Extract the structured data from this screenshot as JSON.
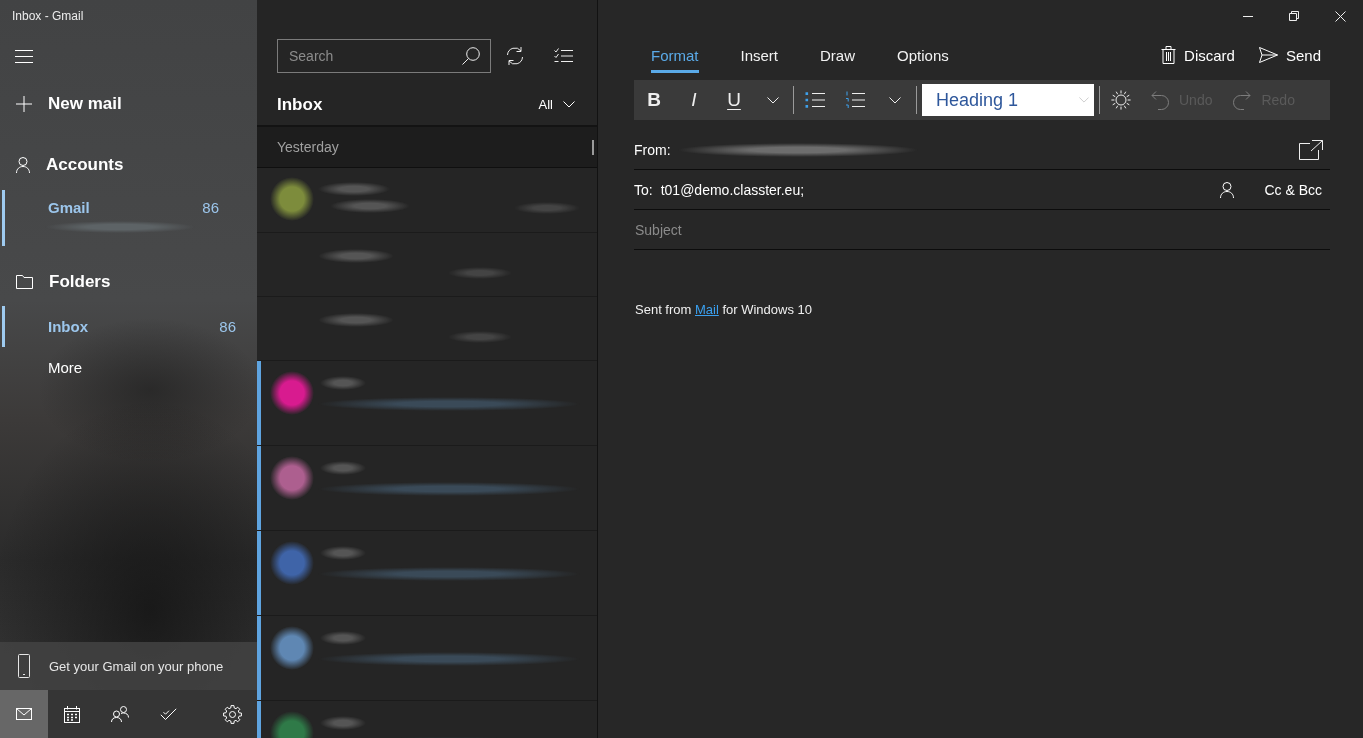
{
  "window": {
    "title": "Inbox - Gmail"
  },
  "sidebar": {
    "new_mail": "New mail",
    "accounts": {
      "label": "Accounts",
      "items": [
        {
          "name": "Gmail",
          "count": "86",
          "selected": true
        }
      ]
    },
    "folders": {
      "label": "Folders",
      "items": [
        {
          "name": "Inbox",
          "count": "86",
          "selected": true
        },
        {
          "name": "More",
          "selected": false
        }
      ]
    },
    "promo": "Get your Gmail on your phone",
    "nav": [
      {
        "kind": "mail",
        "selected": true
      },
      {
        "kind": "calendar",
        "selected": false
      },
      {
        "kind": "people",
        "selected": false
      },
      {
        "kind": "todo",
        "selected": false
      },
      {
        "kind": "settings",
        "selected": false
      }
    ]
  },
  "message_list": {
    "search": {
      "placeholder": "Search"
    },
    "title": "Inbox",
    "filter": "All",
    "group": "Yesterday",
    "messages": [
      {
        "kind": "thread",
        "color": "#7d8c3c",
        "unread": false
      },
      {
        "kind": "reply",
        "unread": false
      },
      {
        "kind": "reply",
        "unread": false
      },
      {
        "kind": "message",
        "color": "#d81b8f",
        "unread": true
      },
      {
        "kind": "message",
        "color": "#ad5f8f",
        "unread": true
      },
      {
        "kind": "message",
        "color": "#3f64a8",
        "unread": true
      },
      {
        "kind": "message",
        "color": "#5f87b3",
        "unread": true
      },
      {
        "kind": "message",
        "color": "#2f7a48",
        "unread": true
      }
    ]
  },
  "compose": {
    "tabs": [
      {
        "label": "Format",
        "selected": true
      },
      {
        "label": "Insert",
        "selected": false
      },
      {
        "label": "Draw",
        "selected": false
      },
      {
        "label": "Options",
        "selected": false
      }
    ],
    "actions": [
      {
        "kind": "discard",
        "label": "Discard"
      },
      {
        "kind": "send",
        "label": "Send"
      }
    ],
    "toolbar": {
      "text_styles": [
        {
          "kind": "bold",
          "glyph": "B"
        },
        {
          "kind": "italic",
          "glyph": "I"
        },
        {
          "kind": "underline",
          "glyph": "U"
        }
      ],
      "paragraph_style": "Heading 1",
      "history": [
        {
          "kind": "undo",
          "label": "Undo",
          "disabled": true
        },
        {
          "kind": "redo",
          "label": "Redo",
          "disabled": true
        }
      ]
    },
    "from": {
      "label": "From:"
    },
    "to": {
      "label": "To:",
      "value": "t01@demo.classter.eu;"
    },
    "cc_bcc": "Cc & Bcc",
    "subject": {
      "placeholder": "Subject"
    },
    "body": {
      "before": "Sent from ",
      "link": "Mail",
      "after": " for Windows 10"
    }
  }
}
